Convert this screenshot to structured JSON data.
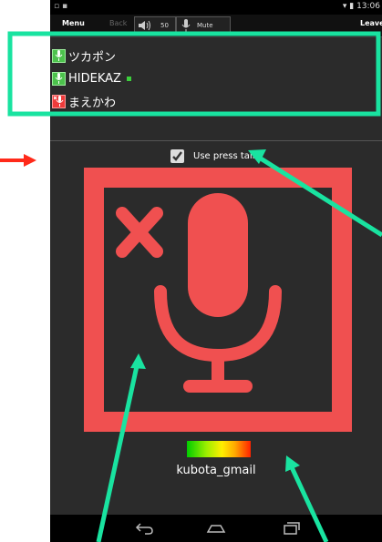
{
  "status_bar": {
    "time": "13:06"
  },
  "action_bar": {
    "menu_label": "Menu",
    "back_label": "Back",
    "volume_value": "50",
    "mute_label": "Mute",
    "leave_label": "Leave"
  },
  "users": [
    {
      "name": "ツカポン",
      "mic": "on",
      "talking": false
    },
    {
      "name": "HIDEKAZ",
      "mic": "on",
      "talking": true
    },
    {
      "name": "まえかわ",
      "mic": "off",
      "talking": false
    }
  ],
  "press_talk": {
    "label": "Use press talk",
    "checked": true
  },
  "mic_state": "muted",
  "level_meter": {
    "gradient_colors": [
      "#00cc00",
      "#ffee00",
      "#ff2200"
    ]
  },
  "current_user": "kubota_gmail",
  "colors": {
    "muted_red": "#f05050",
    "mic_on_green": "#4cc24c",
    "annotation_green": "#19e3a0",
    "annotation_red": "#ff2a1a"
  },
  "icons": {
    "mic_large": "microphone-muted-icon",
    "nav_back": "back-arrow-icon",
    "nav_home": "home-icon",
    "nav_recent": "recent-apps-icon"
  }
}
